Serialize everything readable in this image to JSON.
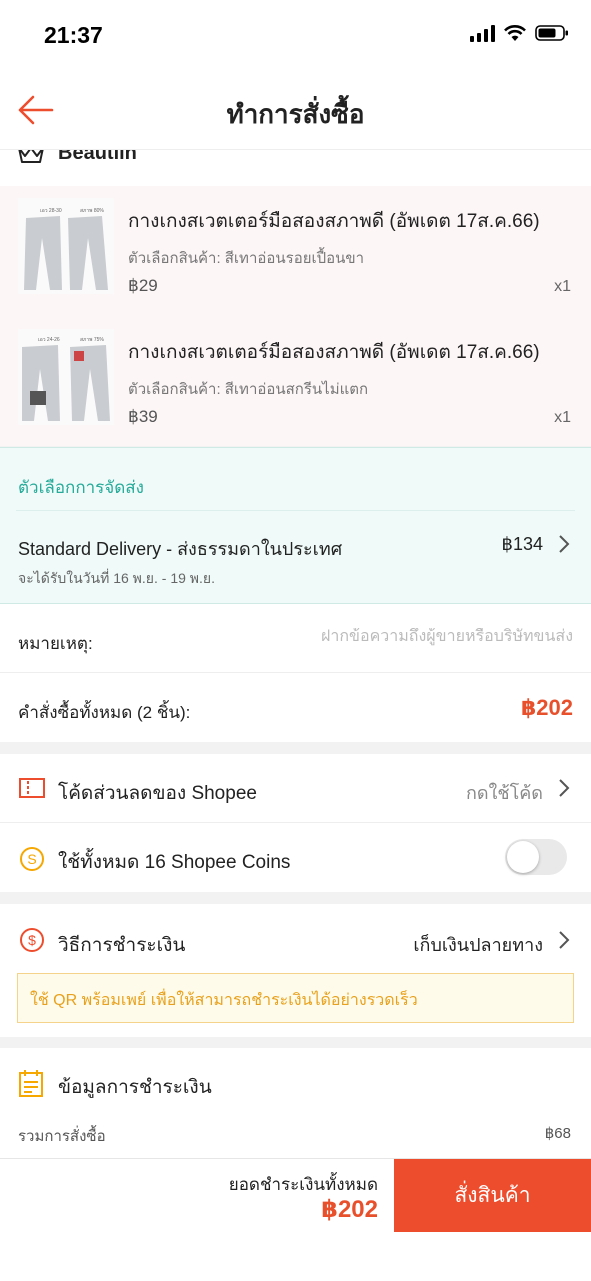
{
  "status_bar": {
    "time": "21:37"
  },
  "header": {
    "title": "ทำการสั่งซื้อ"
  },
  "shop": {
    "name": "Beautiin"
  },
  "products": [
    {
      "title": "กางเกงสเวตเตอร์มือสองสภาพดี (อัพเดต 17ส.ค.66)",
      "variant": "ตัวเลือกสินค้า: สีเทาอ่อนรอยเปื้อนขา",
      "price": "฿29",
      "qty": "x1"
    },
    {
      "title": "กางเกงสเวตเตอร์มือสองสภาพดี (อัพเดต 17ส.ค.66)",
      "variant": "ตัวเลือกสินค้า: สีเทาอ่อนสกรีนไม่แตก",
      "price": "฿39",
      "qty": "x1"
    }
  ],
  "shipping": {
    "heading": "ตัวเลือกการจัดส่ง",
    "method": "Standard Delivery - ส่งธรรมดาในประเทศ",
    "price": "฿134",
    "eta": "จะได้รับในวันที่ 16 พ.ย. - 19 พ.ย."
  },
  "note": {
    "label": "หมายเหตุ:",
    "placeholder": "ฝากข้อความถึงผู้ขายหรือบริษัทขนส่ง"
  },
  "order_total": {
    "label": "คำสั่งซื้อทั้งหมด (2 ชิ้น):",
    "amount": "฿202"
  },
  "voucher": {
    "label": "โค้ดส่วนลดของ Shopee",
    "action": "กดใช้โค้ด"
  },
  "coins": {
    "label": "ใช้ทั้งหมด 16 Shopee Coins",
    "enabled": false
  },
  "payment": {
    "label": "วิธีการชำระเงิน",
    "method": "เก็บเงินปลายทาง",
    "banner": "ใช้ QR พร้อมเพย์ เพื่อให้สามารถชำระเงินได้อย่างรวดเร็ว"
  },
  "payment_info": {
    "title": "ข้อมูลการชำระเงิน",
    "subtotal_label": "รวมการสั่งซื้อ",
    "subtotal_value": "฿68"
  },
  "bottom": {
    "total_label": "ยอดชำระเงินทั้งหมด",
    "total_amount": "฿202",
    "order_button": "สั่งสินค้า"
  },
  "colors": {
    "accent": "#ee4d2d",
    "price": "#e8502c",
    "shipping_teal": "#26aa99",
    "banner_text": "#e8a11c"
  }
}
